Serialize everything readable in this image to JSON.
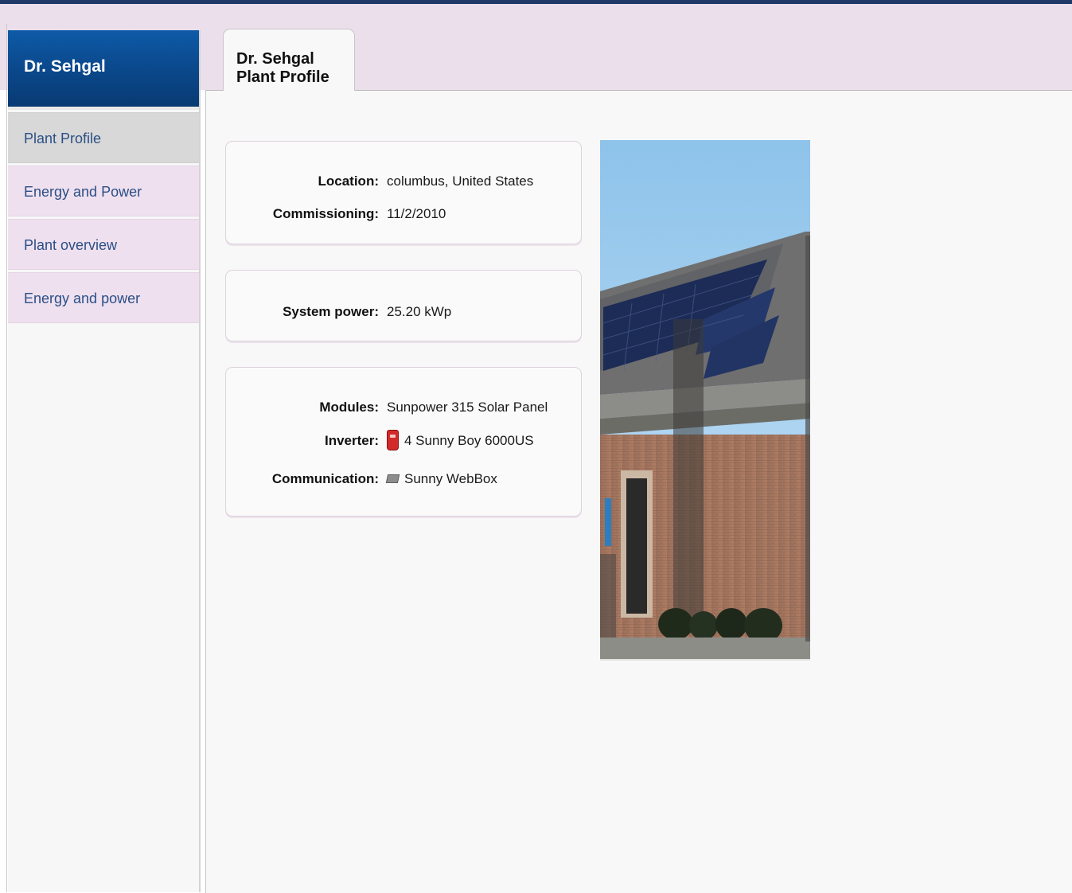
{
  "sidebar": {
    "header": "Dr. Sehgal",
    "items": [
      {
        "label": "Plant Profile",
        "active": true
      },
      {
        "label": "Energy and Power",
        "active": false
      },
      {
        "label": "Plant overview",
        "active": false
      },
      {
        "label": "Energy and power",
        "active": false
      }
    ]
  },
  "main": {
    "tab_label": "Dr. Sehgal Plant Profile",
    "location": {
      "label": "Location:",
      "value": "columbus, United States"
    },
    "commissioning": {
      "label": "Commissioning:",
      "value": "11/2/2010"
    },
    "system_power": {
      "label": "System power:",
      "value": "25.20 kWp"
    },
    "modules": {
      "label": "Modules:",
      "value": "Sunpower 315 Solar Panel"
    },
    "inverter": {
      "label": "Inverter:",
      "value": "4 Sunny Boy 6000US",
      "icon": "inverter-icon"
    },
    "communication": {
      "label": "Communication:",
      "value": "Sunny WebBox",
      "icon": "webbox-icon"
    }
  },
  "colors": {
    "header_blue": "#0b4a8f",
    "band_pink": "#ecdfec",
    "link_blue": "#2b4f86"
  }
}
